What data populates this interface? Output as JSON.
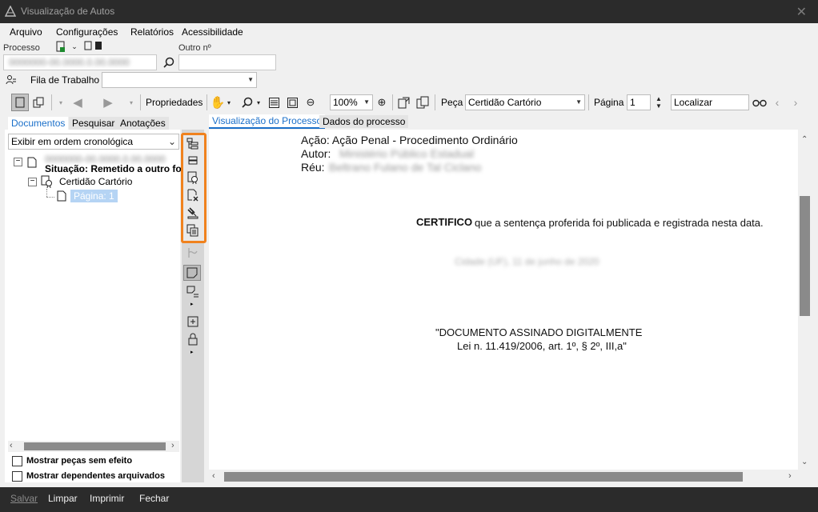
{
  "window": {
    "title": "Visualização de Autos",
    "close_icon": "close-icon"
  },
  "menu": {
    "items": [
      {
        "label": "Arquivo"
      },
      {
        "label": "Configurações"
      },
      {
        "label": "Relatórios"
      },
      {
        "label": "Acessibilidade"
      }
    ]
  },
  "search": {
    "processo_label": "Processo",
    "processo_value": "0000000-00.0000.0.00.0000",
    "outro_label": "Outro nº",
    "outro_value": "",
    "fila_label": "Fila de Trabalho",
    "fila_value": ""
  },
  "toolbar": {
    "propriedades_label": "Propriedades",
    "zoom_value": "100%",
    "peca_label": "Peça",
    "peca_value": "Certidão Cartório",
    "pagina_label": "Página",
    "pagina_value": "1",
    "localizar_value": "Localizar"
  },
  "left_panel": {
    "tabs": [
      {
        "label": "Documentos",
        "active": true
      },
      {
        "label": "Pesquisar",
        "active": false
      },
      {
        "label": "Anotações",
        "active": false
      }
    ],
    "order_select": "Exibir em ordem cronológica",
    "tree": {
      "root_label": "0000000-00.0000.0.00.0000",
      "situacao": "Situação: Remetido a outro foro",
      "doc_label": "Certidão Cartório",
      "page_label": "Página: 1"
    },
    "checkboxes": [
      {
        "label": "Mostrar peças sem efeito",
        "checked": false
      },
      {
        "label": "Mostrar dependentes arquivados",
        "checked": false
      }
    ]
  },
  "right_panel": {
    "tabs": [
      {
        "label": "Visualização do Processo",
        "active": true
      },
      {
        "label": "Dados do processo",
        "active": false
      }
    ],
    "document": {
      "acao": "Ação: Ação Penal - Procedimento Ordinário",
      "autor_label": "Autor:",
      "autor_value": "Ministério Público Estadual",
      "reu_label": "Réu:",
      "reu_value": "Beltrano Fulano de Tal Ciclano",
      "certifico_bold": "CERTIFICO",
      "certifico_rest": " que a sentença proferida foi publicada e registrada nesta data.",
      "blurred_date": "Cidade (UF), 11 de junho de 2020",
      "signed_line1": "\"DOCUMENTO ASSINADO DIGITALMENTE",
      "signed_line2": "Lei n. 11.419/2006, art. 1º, § 2º, III,a\""
    }
  },
  "bottom_bar": {
    "items": [
      {
        "label": "Salvar",
        "enabled": false
      },
      {
        "label": "Limpar",
        "enabled": true
      },
      {
        "label": "Imprimir",
        "enabled": true
      },
      {
        "label": "Fechar",
        "enabled": true
      }
    ]
  },
  "colors": {
    "titlebar_bg": "#2b2b2b",
    "highlight_orange": "#f0821e",
    "active_tab_text": "#1a6fc9",
    "selection_bg": "#b5d4f4"
  }
}
